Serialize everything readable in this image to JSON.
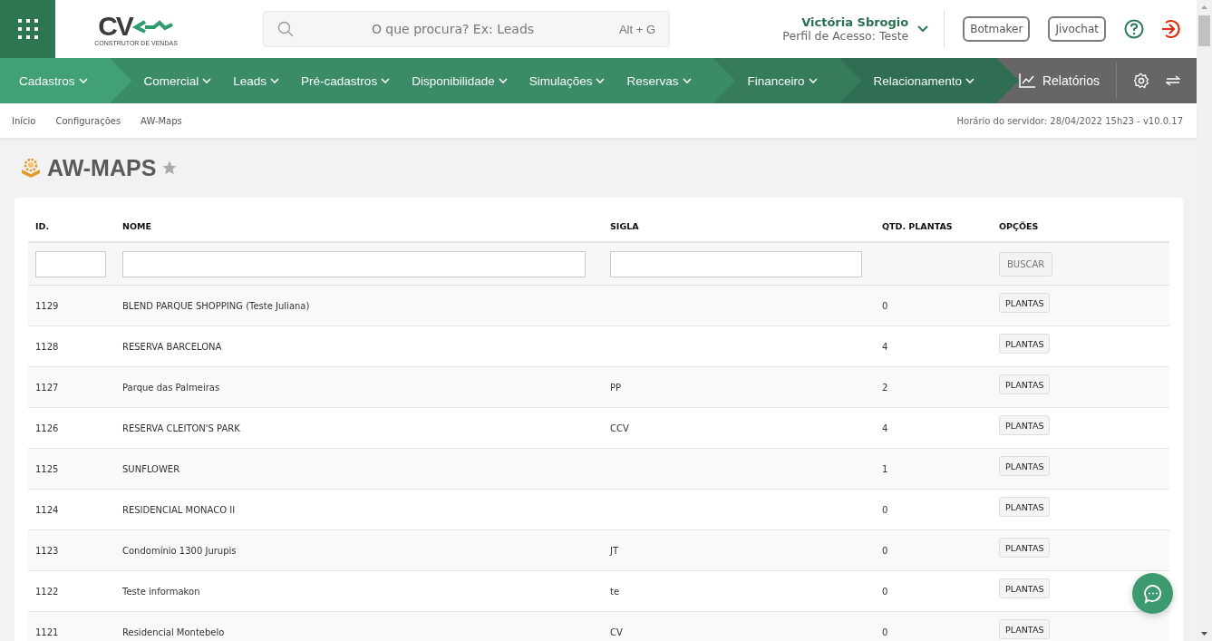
{
  "logo": {
    "mark": "CV",
    "tagline": "CONSTRUTOR DE VENDAS"
  },
  "search": {
    "placeholder": "O que procura? Ex: Leads",
    "shortcut": "Alt + G"
  },
  "user": {
    "name": "Victória Sbrogio",
    "profile": "Perfil de Acesso: Teste"
  },
  "header_buttons": [
    "Botmaker",
    "Jivochat"
  ],
  "nav": [
    {
      "color": "#41a077",
      "items": [
        "Cadastros"
      ]
    },
    {
      "color": "#3b8b69",
      "items": [
        "Comercial",
        "Leads",
        "Pré-cadastros",
        "Disponibilidade",
        "Simulações",
        "Reservas"
      ]
    },
    {
      "color": "#357b5c",
      "items": [
        "Financeiro"
      ]
    },
    {
      "color": "#2f6e52",
      "items": [
        "Relacionamento"
      ]
    }
  ],
  "reports": {
    "label": "Relatórios"
  },
  "breadcrumb": [
    "Início",
    "Configurações",
    "AW-Maps"
  ],
  "server_time": "Horário do servidor: 28/04/2022 15h23 - v10.0.17",
  "page_title": "AW-MAPS",
  "table": {
    "columns": [
      "ID.",
      "NOME",
      "SIGLA",
      "QTD. PLANTAS",
      "OPÇÕES"
    ],
    "search_button": "BUSCAR",
    "rows": [
      {
        "id": "1129",
        "name": "BLEND PARQUE SHOPPING (Teste Juliana)",
        "count": "0",
        "action": "PLANTAS"
      },
      {
        "id": "1128",
        "name": "RESERVA BARCELONA",
        "count": "4",
        "action": "PLANTAS"
      },
      {
        "id": "1127",
        "name": "Parque das Palmeiras",
        "sigla": "PP",
        "count": "2",
        "action": "PLANTAS"
      },
      {
        "id": "1126",
        "name": "RESERVA CLEITON'S PARK",
        "sigla": "CCV",
        "count": "4",
        "action": "PLANTAS"
      },
      {
        "id": "1125",
        "name": "SUNFLOWER",
        "count": "1",
        "action": "PLANTAS"
      },
      {
        "id": "1124",
        "name": "RESIDENCIAL MONACO II",
        "count": "0",
        "action": "PLANTAS"
      },
      {
        "id": "1123",
        "name": "Condomínio 1300 Jurupis",
        "sigla": "JT",
        "count": "0",
        "action": "PLANTAS"
      },
      {
        "id": "1122",
        "name": "Teste informakon",
        "sigla": "te",
        "count": "0",
        "action": "PLANTAS"
      },
      {
        "id": "1121",
        "name": "Residencial Montebelo",
        "sigla": "CV",
        "count": "0",
        "action": "PLANTAS"
      }
    ]
  }
}
